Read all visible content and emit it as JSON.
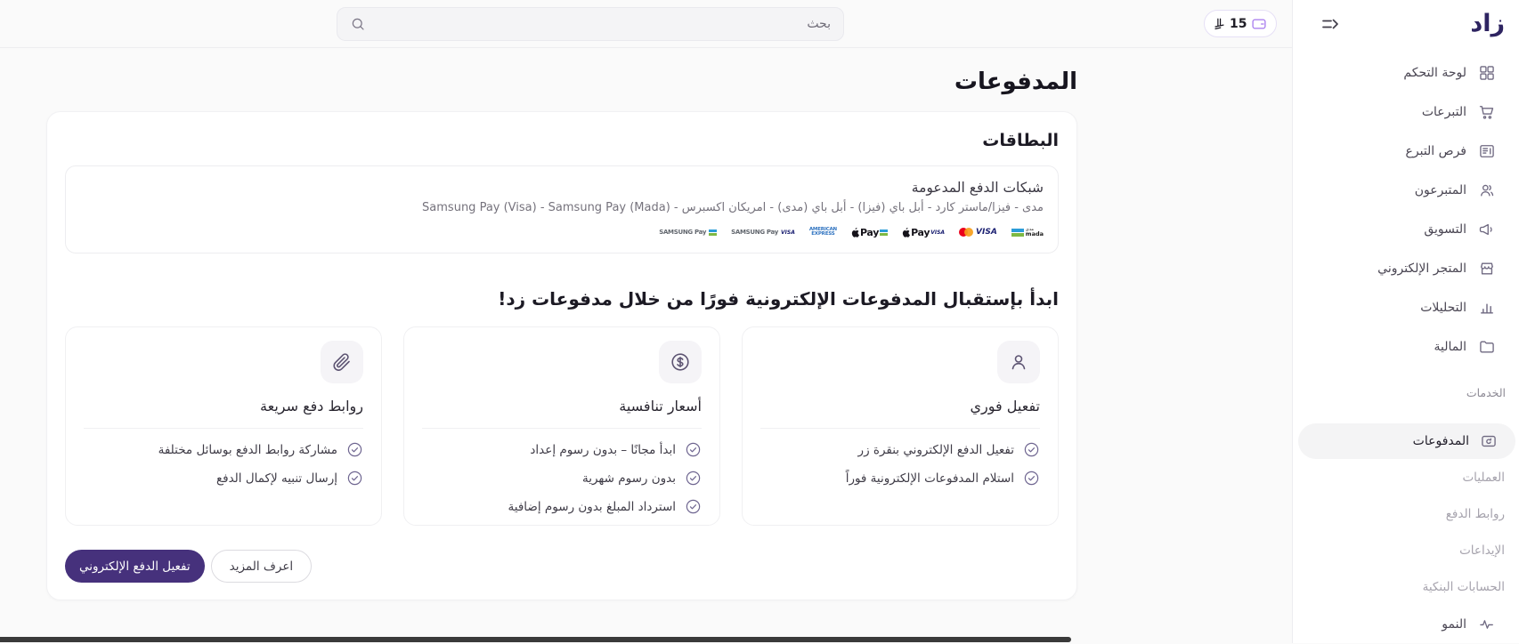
{
  "colors": {
    "primary_purple": "#46317c",
    "accent_purple": "#a477ee",
    "brand_dark_purple": "#2e2461",
    "page_bg": "#fafafa",
    "active_item_bg": "#f4f4f5"
  },
  "topbar": {
    "search_placeholder": "بحث",
    "balance": {
      "amount": "15"
    }
  },
  "sidebar": {
    "logo_text": "زاد",
    "items": [
      {
        "label": "لوحة التحكم",
        "icon": "dashboard-grid"
      },
      {
        "label": "التبرعات",
        "icon": "cart"
      },
      {
        "label": "فرص التبرع",
        "icon": "board"
      },
      {
        "label": "المتبرعون",
        "icon": "users"
      },
      {
        "label": "التسويق",
        "icon": "megaphone"
      },
      {
        "label": "المتجر الإلكتروني",
        "icon": "storefront"
      },
      {
        "label": "التحليلات",
        "icon": "bar-chart"
      },
      {
        "label": "المالية",
        "icon": "wallet-folder"
      }
    ],
    "services": {
      "label": "الخدمات",
      "active_item": {
        "label": "المدفوعات",
        "icon": "payments-card"
      },
      "sub_items": [
        "العمليات",
        "روابط الدفع",
        "الإيداعات",
        "الحسابات البنكية"
      ]
    },
    "growth_item": {
      "label": "النمو",
      "icon": "pulse"
    }
  },
  "page": {
    "title": "المدفوعات",
    "cards_section": {
      "heading": "البطاقات",
      "networks_box": {
        "title": "شبكات الدفع المدعومة",
        "description": "مدى - فيزا/ماستر كارد - أبل باي (فيزا) - أبل باي (مدى) - امريكان اكسبرس - Samsung Pay (Visa) - Samsung Pay (Mada)",
        "logos": [
          "samsung-pay-mada",
          "samsung-pay-visa",
          "american-express",
          "apple-pay-mada",
          "apple-pay-visa",
          "mastercard-visa",
          "mada"
        ],
        "logo_labels": {
          "samsung_pay": "SAMSUNG Pay",
          "visa": "VISA",
          "amex_top": "AMERICAN",
          "amex_bottom": "EXPRESS",
          "apple_pay": "Pay",
          "mada_ar": "مدى",
          "mada_en": "mada"
        }
      }
    },
    "promo_section": {
      "heading": "ابدأ بإستقبال المدفوعات الإلكترونية فورًا من خلال مدفوعات زد!",
      "features": [
        {
          "icon": "user",
          "title": "تفعيل فوري",
          "bullets": [
            "تفعيل الدفع الإلكتروني بنقرة زر",
            "استلام المدفوعات الإلكترونية فوراً"
          ]
        },
        {
          "icon": "dollar-circle",
          "title": "أسعار تنافسية",
          "bullets": [
            "ابدأ مجانًا – بدون رسوم إعداد",
            "بدون رسوم شهرية",
            "استرداد المبلغ بدون رسوم إضافية"
          ]
        },
        {
          "icon": "paperclip",
          "title": "روابط دفع سريعة",
          "bullets": [
            "مشاركة روابط الدفع بوسائل مختلفة",
            "إرسال تنبيه لإكمال الدفع"
          ]
        }
      ],
      "buttons": {
        "secondary": "اعرف المزيد",
        "primary": "تفعيل الدفع الإلكتروني"
      }
    }
  }
}
